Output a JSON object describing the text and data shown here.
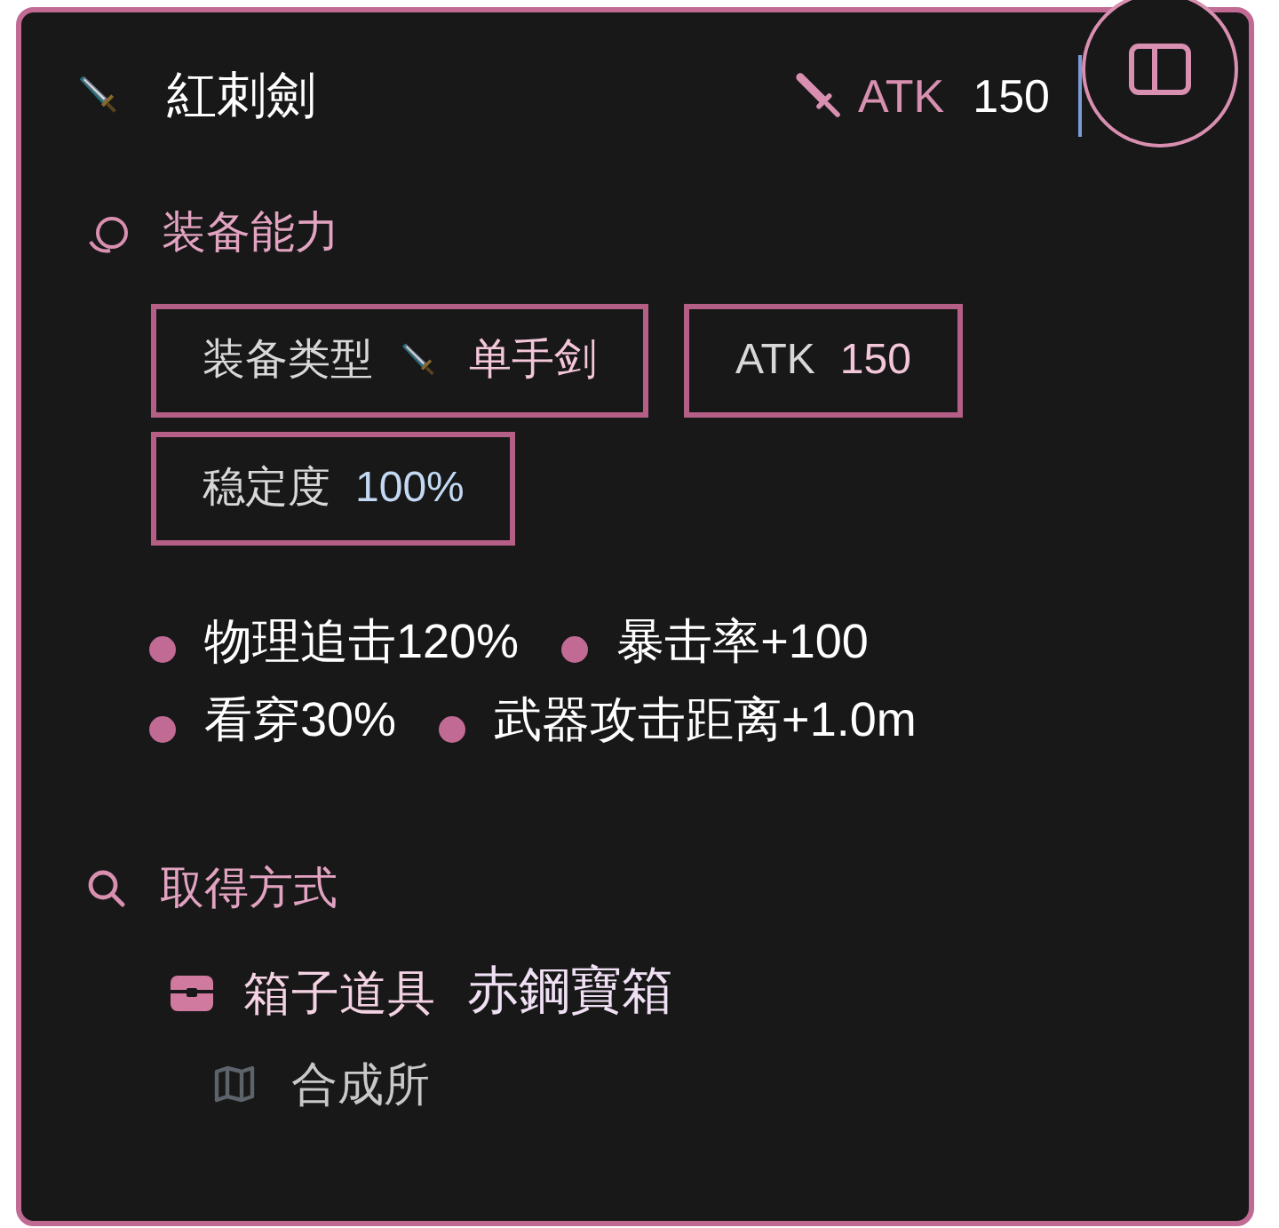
{
  "item": {
    "name": "紅刺劍",
    "stat_label": "ATK",
    "stat_value": "150"
  },
  "abilities": {
    "title": "装备能力",
    "tags": [
      {
        "kind": "weapon_type",
        "label": "装备类型",
        "value": "单手剑",
        "color": "#f4c6da"
      },
      {
        "kind": "stat",
        "label": "ATK",
        "value": "150",
        "color": "#f4c6da"
      },
      {
        "kind": "stat",
        "label": "稳定度",
        "value": "100%",
        "color": "#c3d9f3"
      }
    ],
    "effects": [
      "物理追击120%",
      "暴击率+100",
      "看穿30%",
      "武器攻击距离+1.0m"
    ]
  },
  "acquisition": {
    "title": "取得方式",
    "sources": [
      {
        "kind": "chest",
        "category": "箱子道具",
        "name": "赤鋼寶箱"
      },
      {
        "kind": "place",
        "name": "合成所"
      }
    ]
  }
}
